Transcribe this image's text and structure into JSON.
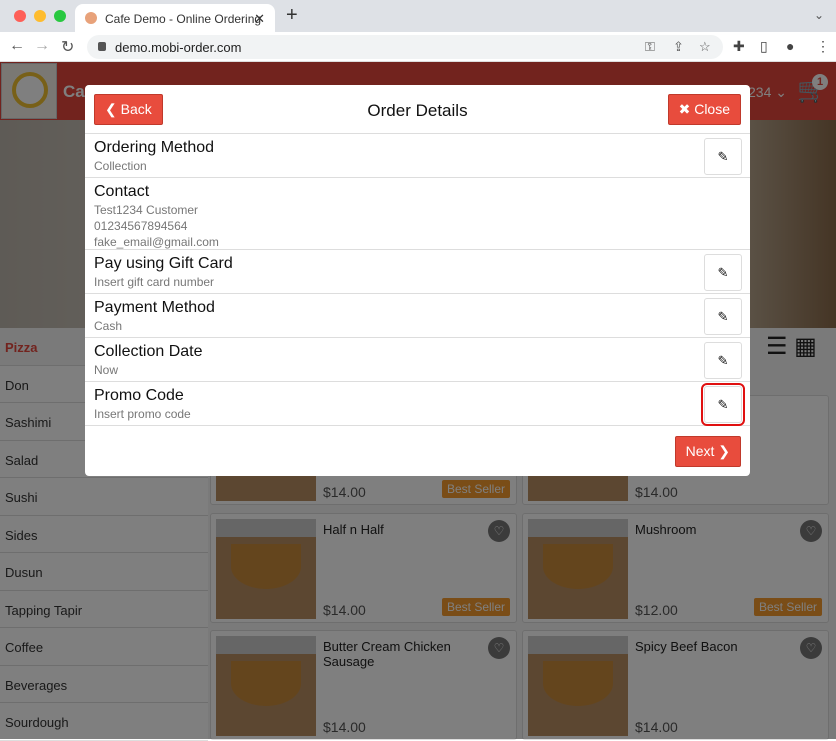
{
  "browser": {
    "tab_title": "Cafe Demo - Online Ordering",
    "url": "demo.mobi-order.com"
  },
  "app": {
    "title": "Cafe",
    "user": "234",
    "cart_count": "1"
  },
  "categories": [
    "Pizza",
    "Don",
    "Sashimi",
    "Salad",
    "Sushi",
    "Sides",
    "Dusun",
    "Tapping Tapir",
    "Coffee",
    "Beverages",
    "Sourdough"
  ],
  "products": [
    {
      "name": "",
      "price": "$14.00",
      "badge": "Best Seller"
    },
    {
      "name": "",
      "price": "$14.00",
      "badge": ""
    },
    {
      "name": "Half n Half",
      "price": "$14.00",
      "badge": "Best Seller"
    },
    {
      "name": "Mushroom",
      "price": "$12.00",
      "badge": "Best Seller"
    },
    {
      "name": "Butter Cream Chicken Sausage",
      "price": "$14.00",
      "badge": ""
    },
    {
      "name": "Spicy Beef Bacon",
      "price": "$14.00",
      "badge": ""
    }
  ],
  "modal": {
    "title": "Order Details",
    "back": "Back",
    "close": "Close",
    "next": "Next",
    "rows": [
      {
        "title": "Ordering Method",
        "lines": [
          "Collection"
        ],
        "editable": true
      },
      {
        "title": "Contact",
        "lines": [
          "Test1234 Customer",
          "01234567894564",
          "fake_email@gmail.com"
        ],
        "editable": false
      },
      {
        "title": "Pay using Gift Card",
        "lines": [
          "Insert gift card number"
        ],
        "editable": true
      },
      {
        "title": "Payment Method",
        "lines": [
          "Cash"
        ],
        "editable": true
      },
      {
        "title": "Collection Date",
        "lines": [
          "Now"
        ],
        "editable": true
      },
      {
        "title": "Promo Code",
        "lines": [
          "Insert promo code"
        ],
        "editable": true,
        "highlighted": true
      }
    ]
  },
  "colors": {
    "accent": "#e84c3d",
    "badge": "#f49b2f",
    "highlight": "#e01010"
  }
}
